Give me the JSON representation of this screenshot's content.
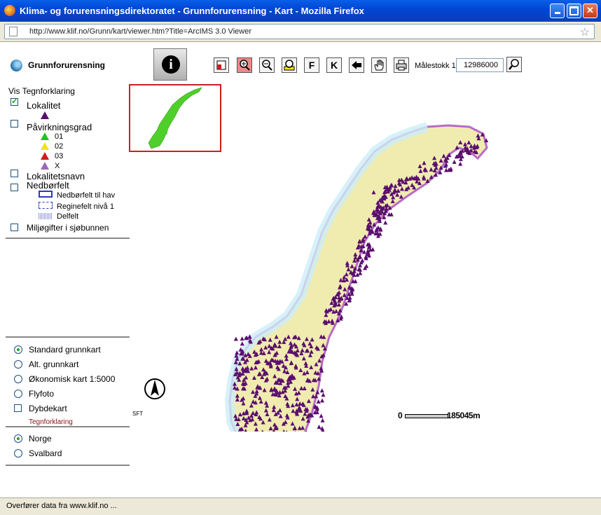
{
  "window": {
    "title": "Klima- og forurensningsdirektoratet - Grunnforurensning - Kart - Mozilla Firefox",
    "url": "http://www.klif.no/Grunn/kart/viewer.htm?Title=ArcIMS 3.0 Viewer",
    "status": "Overfører data fra www.klif.no ..."
  },
  "app": {
    "name": "Grunnforurensning",
    "info_button": "i",
    "toolbar": {
      "tools": [
        "layers-icon",
        "zoom-in-icon",
        "zoom-out-icon",
        "zoom-full-icon",
        "F",
        "K",
        "back-icon",
        "pan-hand-icon",
        "print-icon"
      ],
      "scale_label": "Målestokk 1:",
      "scale_value": "12986000"
    }
  },
  "legend": {
    "header": "Vis Tegnforklaring",
    "items": [
      {
        "label": "Lokalitet",
        "checked": true
      },
      {
        "label": "Påvirkningsgrad",
        "checked": false
      },
      {
        "label": "Lokalitetsnavn",
        "checked": false
      },
      {
        "label": "Nedbørfelt",
        "checked": false
      },
      {
        "label": "Miljøgifter i sjøbunnen",
        "checked": false
      }
    ],
    "grades": [
      {
        "label": "01",
        "color": "#22c322"
      },
      {
        "label": "02",
        "color": "#f2e21a"
      },
      {
        "label": "03",
        "color": "#d11c1c"
      },
      {
        "label": "X",
        "color": "#9a69b8"
      }
    ],
    "catchments": [
      {
        "label": "Nedbørfelt til hav"
      },
      {
        "label": "Reginefelt nivå 1"
      },
      {
        "label": "Delfelt"
      }
    ]
  },
  "basemaps": {
    "options": [
      {
        "label": "Standard grunnkart",
        "selected": true
      },
      {
        "label": "Alt. grunnkart",
        "selected": false
      },
      {
        "label": "Økonomisk kart 1:5000",
        "selected": false
      },
      {
        "label": "Flyfoto",
        "selected": false
      }
    ],
    "depth_label": "Dybdekart",
    "legend_link": "Tegnforklaring"
  },
  "regions": {
    "options": [
      {
        "label": "Norge",
        "selected": true
      },
      {
        "label": "Svalbard",
        "selected": false
      }
    ]
  },
  "map": {
    "scalebar_zero": "0",
    "scalebar_distance": "185045m",
    "sft_label": "SFT",
    "colors": {
      "land": "#f0ecb0",
      "water": "#cdeef7",
      "border": "#b86ac8",
      "locality": "#5a0e6d",
      "overview_land": "#4fcf2a"
    }
  }
}
